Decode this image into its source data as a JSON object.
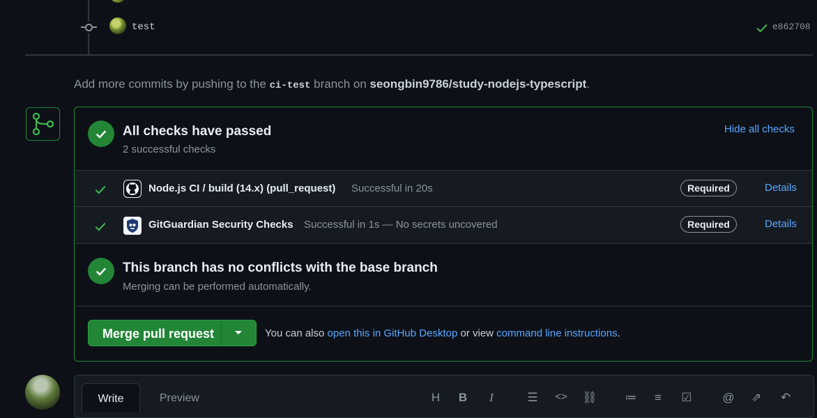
{
  "commit": {
    "message": "test",
    "sha": "e862708"
  },
  "add_commits": {
    "prefix": "Add more commits by pushing to the ",
    "branch": "ci-test",
    "middle": " branch on ",
    "repo": "seongbin9786/study-nodejs-typescript",
    "suffix": "."
  },
  "checks": {
    "title": "All checks have passed",
    "subtitle": "2 successful checks",
    "toggle_label": "Hide all checks",
    "items": [
      {
        "name": "Node.js CI / build (14.x) (pull_request)",
        "status": "Successful in 20s",
        "badge": "Required",
        "details": "Details",
        "app_icon": "github-icon"
      },
      {
        "name": "GitGuardian Security Checks",
        "status": "Successful in 1s — No secrets uncovered",
        "badge": "Required",
        "details": "Details",
        "app_icon": "gitguardian-icon"
      }
    ]
  },
  "conflicts": {
    "title": "This branch has no conflicts with the base branch",
    "subtitle": "Merging can be performed automatically."
  },
  "merge": {
    "button_label": "Merge pull request",
    "also_prefix": "You can also ",
    "desktop_link": "open this in GitHub Desktop",
    "or_view": " or view ",
    "cli_link": "command line instructions",
    "suffix": "."
  },
  "editor": {
    "tab_write": "Write",
    "tab_preview": "Preview"
  },
  "colors": {
    "success": "#238636",
    "link": "#58a6ff",
    "background": "#0d1117"
  }
}
